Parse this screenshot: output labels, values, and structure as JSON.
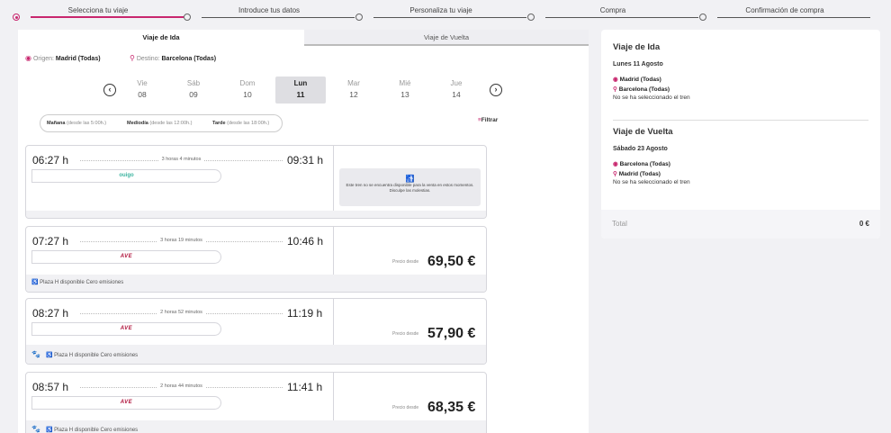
{
  "stepper": {
    "steps": [
      {
        "label": "Selecciona tu viaje"
      },
      {
        "label": "Introduce tus datos"
      },
      {
        "label": "Personaliza tu viaje"
      },
      {
        "label": "Compra"
      },
      {
        "label": "Confirmación de compra"
      }
    ],
    "active_index": 0
  },
  "tabs": {
    "outbound": "Viaje de Ida",
    "return": "Viaje de Vuelta"
  },
  "route": {
    "origin_label": "Origen:",
    "origin": "Madrid (Todas)",
    "dest_label": "Destino:",
    "dest": "Barcelona (Todas)"
  },
  "days": [
    {
      "name": "Vie",
      "num": "08"
    },
    {
      "name": "Sáb",
      "num": "09"
    },
    {
      "name": "Dom",
      "num": "10"
    },
    {
      "name": "Lun",
      "num": "11"
    },
    {
      "name": "Mar",
      "num": "12"
    },
    {
      "name": "Mié",
      "num": "13"
    },
    {
      "name": "Jue",
      "num": "14"
    }
  ],
  "time_filter": {
    "morning": "Mañana",
    "morning_range": "(desde las 5:00h.)",
    "noon": "Mediodía",
    "noon_range": "(desde las 12:00h.)",
    "evening": "Tarde",
    "evening_range": "(desde las 18:00h.)"
  },
  "filter_label": "Filtrar",
  "trains": [
    {
      "dep": "06:27 h",
      "arr": "09:31 h",
      "duration": "3 horas 4 minutos",
      "brand": "ouigo",
      "unavailable": "Este tren no se encuentra disponible para la venta en estos momentos. Disculpe las molestias."
    },
    {
      "dep": "07:27 h",
      "arr": "10:46 h",
      "duration": "3 horas 19 minutos",
      "brand": "AVE",
      "price_label": "Precio desde",
      "price": "69,50 €",
      "features": "Plaza H disponible  Cero emisiones"
    },
    {
      "dep": "08:27 h",
      "arr": "11:19 h",
      "duration": "2 horas 52 minutos",
      "brand": "AVE",
      "price_label": "Precio desde",
      "price": "57,90 €",
      "features": "Plaza H disponible  Cero emisiones"
    },
    {
      "dep": "08:57 h",
      "arr": "11:41 h",
      "duration": "2 horas 44 minutos",
      "brand": "AVE",
      "price_label": "Precio desde",
      "price": "68,35 €",
      "features": "Plaza H disponible  Cero emisiones"
    }
  ],
  "summary": {
    "outbound": {
      "title": "Viaje de Ida",
      "date": "Lunes 11 Agosto",
      "from": "Madrid (Todas)",
      "to": "Barcelona (Todas)",
      "none": "No se ha seleccionado el tren"
    },
    "return": {
      "title": "Viaje de Vuelta",
      "date": "Sábado 23 Agosto",
      "from": "Barcelona (Todas)",
      "to": "Madrid (Todas)",
      "none": "No se ha seleccionado el tren"
    },
    "total_label": "Total",
    "total_value": "0 €"
  },
  "colors": {
    "accent": "#c8276e",
    "ave": "#b0143c",
    "ouigo": "#3cb4a0"
  }
}
